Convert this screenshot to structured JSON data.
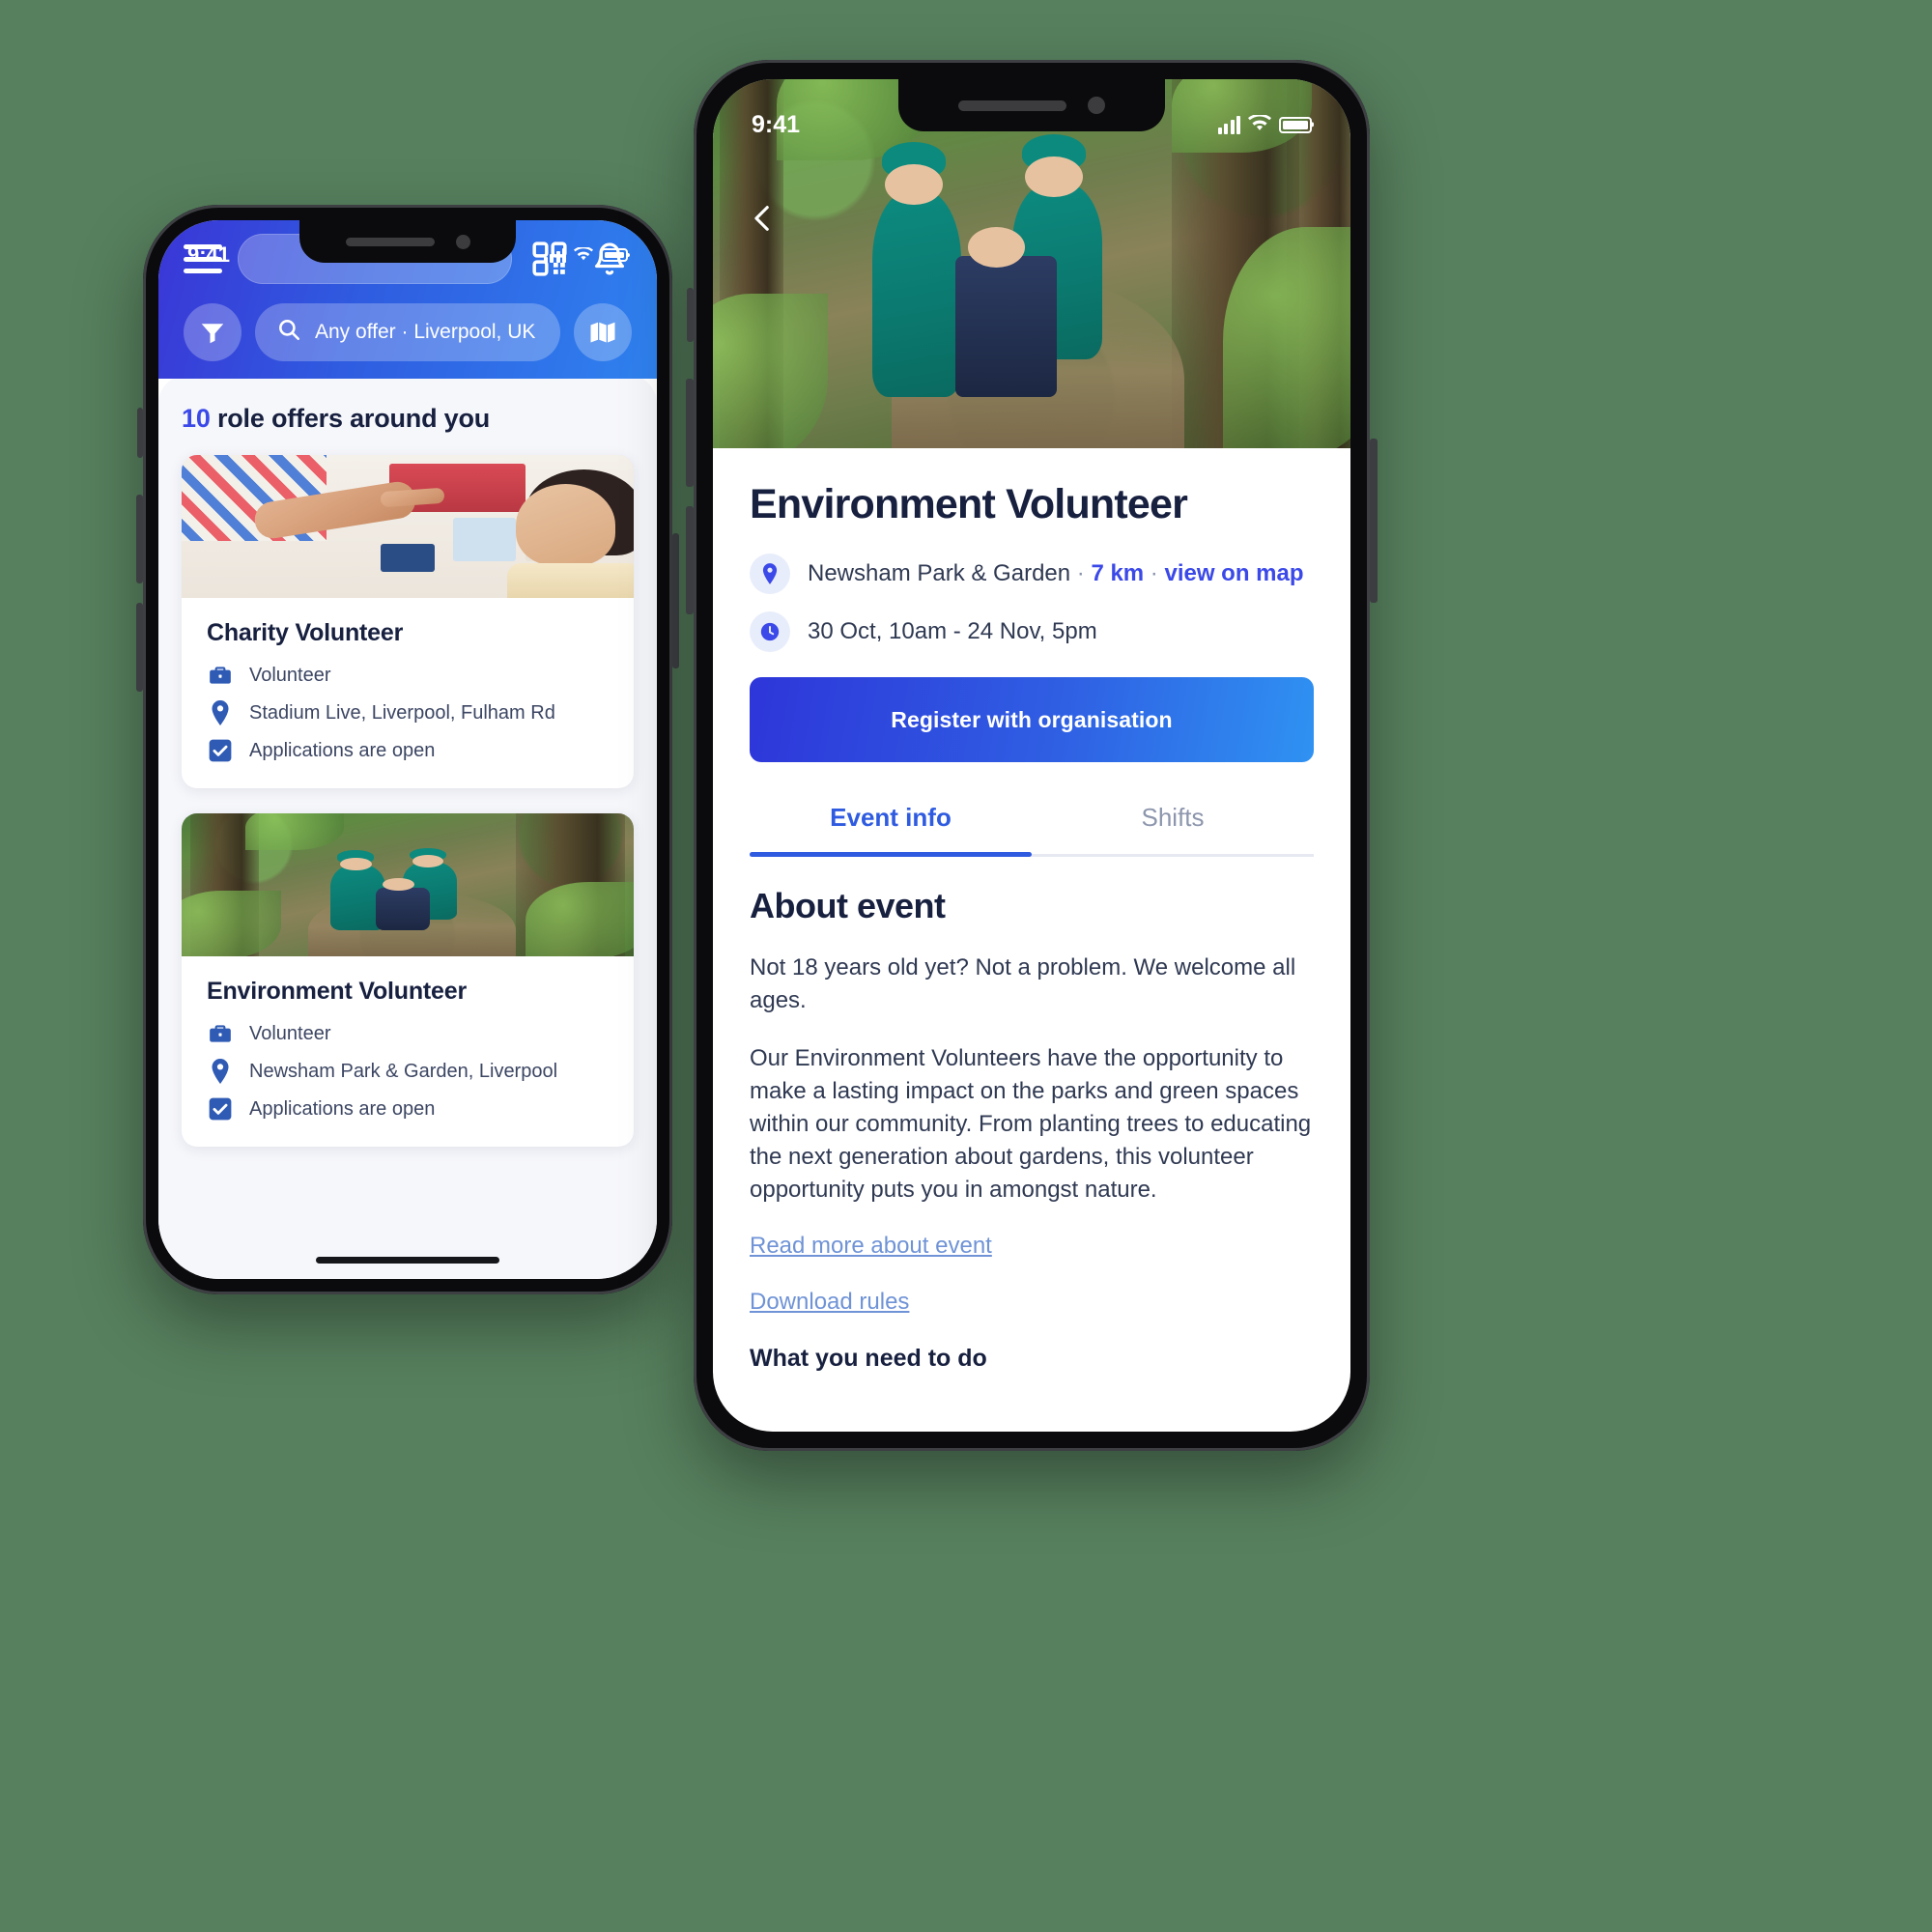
{
  "left_phone": {
    "status_bar": {
      "time": "9:41",
      "signal_icon": "cellular-signal-icon",
      "wifi_icon": "wifi-icon",
      "battery_icon": "battery-icon"
    },
    "header": {
      "menu_icon": "hamburger-menu-icon",
      "search_field_value": "",
      "qr_icon": "qr-code-icon",
      "bell_icon": "notification-bell-icon",
      "filter_icon": "filter-funnel-icon",
      "map_icon": "map-icon",
      "search_icon": "search-icon",
      "search_value": "Any offer · Liverpool, UK",
      "search_placeholder": "Any offer · Liverpool, UK"
    },
    "results": {
      "count": "10",
      "heading_rest": " role offers around you",
      "cards": [
        {
          "title": "Charity Volunteer",
          "photo": "charity-volunteer-photo",
          "role_icon": "briefcase-icon",
          "role": "Volunteer",
          "location_icon": "location-pin-icon",
          "location": "Stadium Live, Liverpool, Fulham Rd",
          "status_icon": "checkbox-checked-icon",
          "status": "Applications are open"
        },
        {
          "title": "Environment Volunteer",
          "photo": "environment-volunteer-photo",
          "role_icon": "briefcase-icon",
          "role": "Volunteer",
          "location_icon": "location-pin-icon",
          "location": "Newsham Park & Garden, Liverpool",
          "status_icon": "checkbox-checked-icon",
          "status": "Applications are open"
        }
      ]
    }
  },
  "right_phone": {
    "status_bar": {
      "time": "9:41",
      "signal_icon": "cellular-signal-icon",
      "wifi_icon": "wifi-icon",
      "battery_icon": "battery-icon"
    },
    "hero": {
      "photo": "environment-volunteer-hero-photo",
      "back_icon": "chevron-left-icon"
    },
    "detail": {
      "title": "Environment Volunteer",
      "location_icon": "location-pin-icon",
      "location": "Newsham Park & Garden",
      "distance": "7 km",
      "map_link": "view on map",
      "separator": " · ",
      "time_icon": "clock-icon",
      "datetime": "30 Oct, 10am - 24 Nov, 5pm",
      "cta_label": "Register with organisation"
    },
    "tabs": [
      {
        "label": "Event info",
        "active": true
      },
      {
        "label": "Shifts",
        "active": false
      }
    ],
    "about": {
      "heading": "About event",
      "paragraph_1": "Not 18 years old yet? Not a problem. We welcome all ages.",
      "paragraph_2": "Our Environment Volunteers have the opportunity to make a lasting impact on the parks and green spaces within our community. From planting trees to educating the next generation about gardens, this volunteer opportunity puts you in amongst nature.",
      "read_more_link": "Read more about event",
      "download_link": "Download rules",
      "next_section": "What you need to do"
    }
  },
  "colors": {
    "brand_blue": "#2f5be0",
    "accent_indigo": "#3b49e8",
    "navy_text": "#17203f",
    "page_bg": "#57805e",
    "card_bg": "#ffffff",
    "body_bg": "#f6f7fb"
  }
}
